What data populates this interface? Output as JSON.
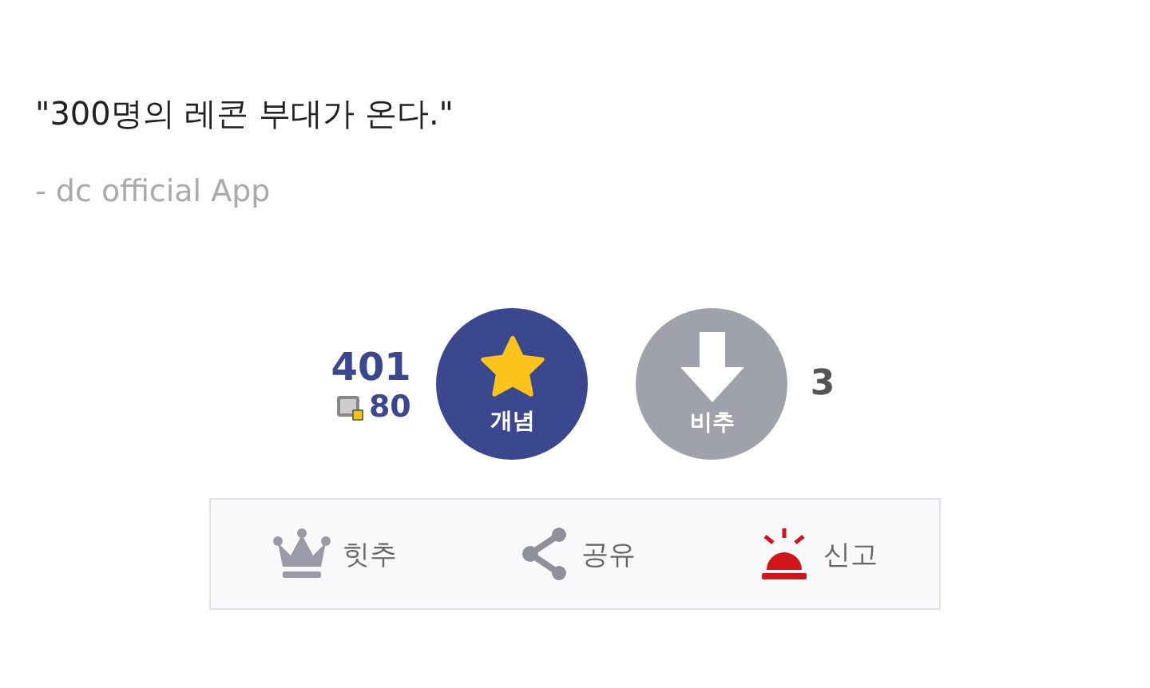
{
  "post": {
    "quote": "\"300명의 레콘 부대가 온다.\"",
    "signature": "- dc official App"
  },
  "votes": {
    "up_count": "401",
    "fixed_count": "80",
    "up_label": "개념",
    "down_label": "비추",
    "down_count": "3"
  },
  "actions": [
    {
      "kind": "crown",
      "label": "힛추"
    },
    {
      "kind": "share",
      "label": "공유"
    },
    {
      "kind": "siren",
      "label": "신고"
    }
  ]
}
